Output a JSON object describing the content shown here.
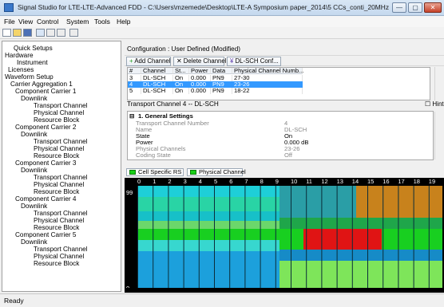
{
  "window": {
    "title": "Signal Studio for LTE-LTE-Advanced FDD - C:\\Users\\mzemede\\Desktop\\LTE-A Symposium paper_2014\\5 CCs_conti_20MHz each.scp*",
    "buttons": {
      "minimize": "—",
      "maximize": "▢",
      "close": "✕"
    }
  },
  "menu": [
    "File",
    "View",
    "Control",
    "System",
    "Tools",
    "Help"
  ],
  "toolbar_icons": [
    "new-file-icon",
    "open-folder-icon",
    "save-icon",
    "grid-icon",
    "sort-icon",
    "alpha-sort-icon",
    "checkbox-icon"
  ],
  "tree": [
    "Quick Setups",
    "Hardware",
    "Instrument",
    "Licenses",
    "Waveform Setup",
    "Carrier Aggregation 1",
    "Component Carrier 1",
    "Downlink",
    "Transport Channel",
    "Physical Channel",
    "Resource Block",
    "Component Carrier 2",
    "Downlink",
    "Transport Channel",
    "Physical Channel",
    "Resource Block",
    "Component Carrier 3",
    "Downlink",
    "Transport Channel",
    "Physical Channel",
    "Resource Block",
    "Component Carrier 4",
    "Downlink",
    "Transport Channel",
    "Physical Channel",
    "Resource Block",
    "Component Carrier 5",
    "Downlink",
    "Transport Channel",
    "Physical Channel",
    "Resource Block"
  ],
  "config_label": "Configuration : User Defined (Modified)",
  "buttons": {
    "add_channel": "Add Channel",
    "delete_channel": "Delete Channel",
    "dl_sch_conf": "DL-SCH Conf..."
  },
  "table": {
    "headers": [
      "#",
      "Channel",
      "St...",
      "Power",
      "Data",
      "Physical Channel Numb..."
    ],
    "rows": [
      [
        "3",
        "DL-SCH",
        "On",
        "0.000",
        "PN9",
        "27-30"
      ],
      [
        "4",
        "DL-SCH",
        "On",
        "0.000",
        "PN9",
        "23-26"
      ],
      [
        "5",
        "DL-SCH",
        "On",
        "0.000",
        "PN9",
        "18-22"
      ]
    ],
    "selected_index": 1
  },
  "transport_label": "Transport Channel 4 -- DL-SCH",
  "hint_label": "Hint",
  "properties": {
    "section": "1. General Settings",
    "items": [
      {
        "name": "Transport Channel Number",
        "value": "4"
      },
      {
        "name": "Name",
        "value": "DL-SCH"
      },
      {
        "name": "State",
        "value": "On"
      },
      {
        "name": "Power",
        "value": "0.000 dB"
      },
      {
        "name": "Physical Channels",
        "value": "23-26"
      },
      {
        "name": "Coding State",
        "value": "Off"
      }
    ]
  },
  "legend": [
    "Cell Specific RS",
    "Physical Channel"
  ],
  "resource_grid": {
    "x_ticks": [
      "0",
      "1",
      "2",
      "3",
      "4",
      "5",
      "6",
      "7",
      "8",
      "9",
      "10",
      "11",
      "12",
      "13",
      "14",
      "15",
      "16",
      "17",
      "18",
      "19"
    ],
    "y_top": "99",
    "y_bottom": "0"
  },
  "status": "Ready"
}
